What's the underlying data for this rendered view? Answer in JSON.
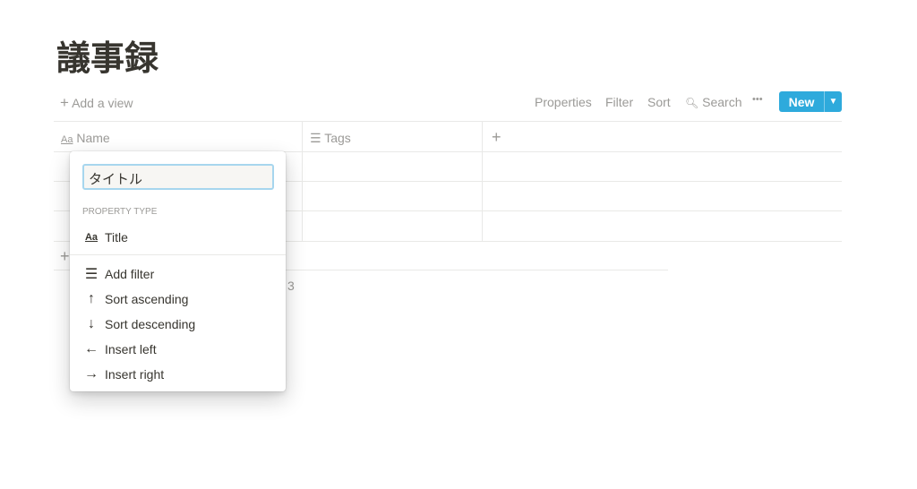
{
  "page": {
    "title": "議事録"
  },
  "toolbar": {
    "add_view": "Add a view",
    "properties": "Properties",
    "filter": "Filter",
    "sort": "Sort",
    "search": "Search",
    "more": "•••",
    "new": "New",
    "new_dropdown": "⌄"
  },
  "table": {
    "columns": [
      {
        "label": "Name",
        "icon": "Aa"
      },
      {
        "label": "Tags",
        "icon": "☰"
      }
    ],
    "add_column": "+",
    "add_row": "+",
    "count": "3"
  },
  "menu": {
    "input_value": "タイトル",
    "section_label": "PROPERTY TYPE",
    "type": {
      "icon": "Aa",
      "label": "Title"
    },
    "items": [
      {
        "icon": "☰",
        "label": "Add filter"
      },
      {
        "icon": "↑",
        "label": "Sort ascending"
      },
      {
        "icon": "↓",
        "label": "Sort descending"
      },
      {
        "icon": "←",
        "label": "Insert left"
      },
      {
        "icon": "→",
        "label": "Insert right"
      }
    ]
  },
  "colors": {
    "accent": "#2eaadc"
  }
}
